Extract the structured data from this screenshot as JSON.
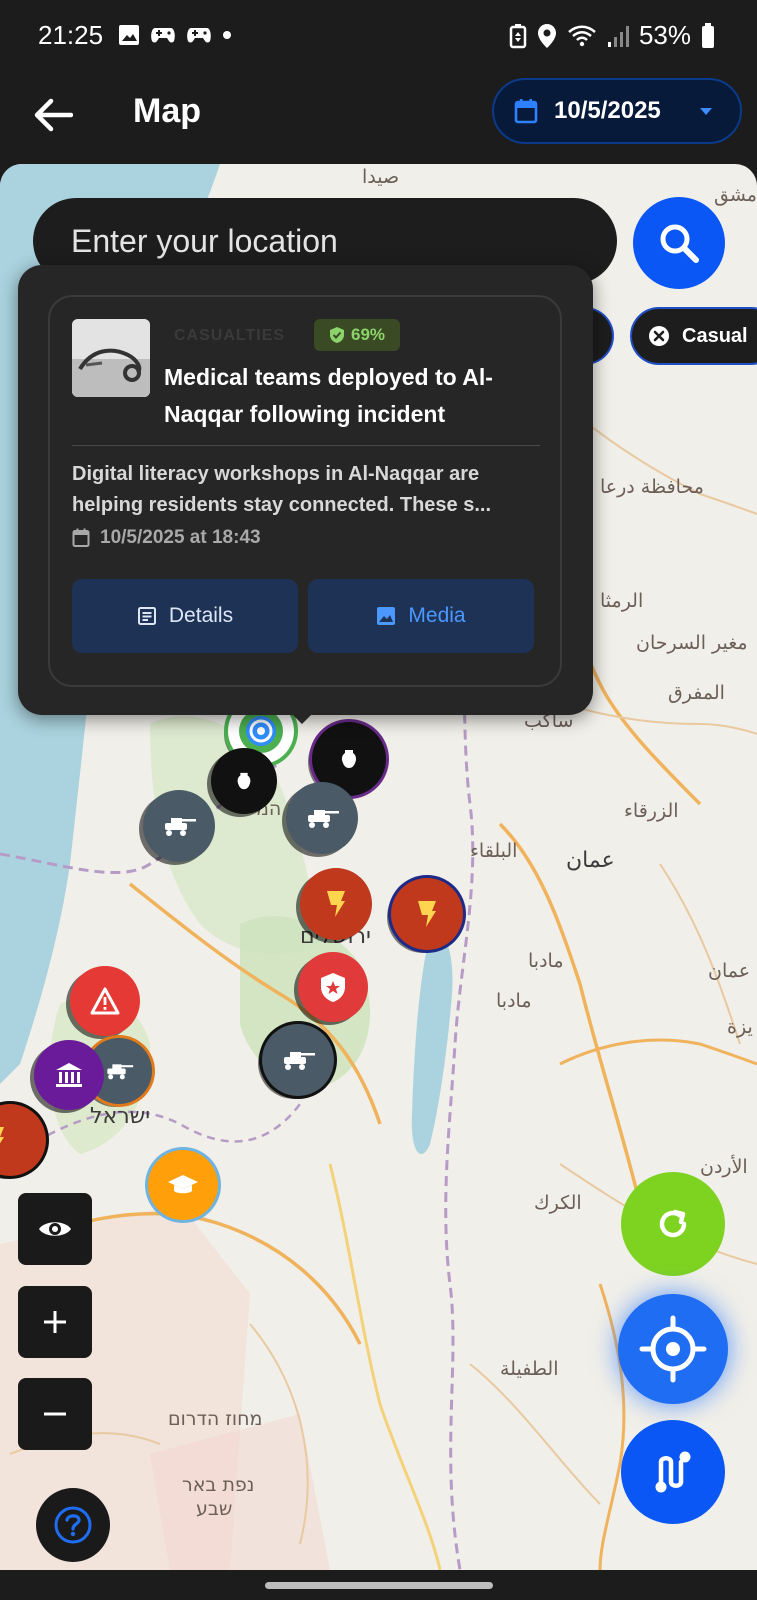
{
  "status_bar": {
    "time": "21:25",
    "battery": "53%",
    "icons_left": [
      "image-icon",
      "game-controller-icon",
      "game-controller-icon",
      "dot-icon"
    ],
    "icons_right": [
      "battery-saver-icon",
      "location-pin-icon",
      "wifi-icon",
      "signal-icon",
      "battery-icon"
    ]
  },
  "header": {
    "title": "Map",
    "date": "10/5/2025",
    "accent_color": "#0a57f5"
  },
  "search": {
    "placeholder": "Enter your location"
  },
  "filters": {
    "active_chip": "Casual"
  },
  "popup": {
    "category": "CASUALTIES",
    "confidence": "69%",
    "title": "Medical teams deployed to Al-Naqqar following incident",
    "description": "Digital literacy workshops in Al-Naqqar are helping residents stay connected. These s...",
    "date": "10/5/2025 at 18:43",
    "details_label": "Details",
    "media_label": "Media"
  },
  "map_labels": {
    "saida": "صيدا",
    "damascus": "دمشق",
    "daraa": "محافظة درعا",
    "ramtha": "الرمثا",
    "mughayyir": "مغير السرحان",
    "mafraq": "المفرق",
    "sakib": "ساكب",
    "zarqa": "الزرقاء",
    "balqa": "البلقاء",
    "amman": "عمان",
    "jerusalem": "ירושלים",
    "madaba1": "مادبا",
    "madaba2": "مادبا",
    "amman2": "عمان",
    "israel": "ישראל",
    "karak": "الكرك",
    "jordan": "الأردن",
    "tafila": "الطفيلة",
    "southern_district": "מחוז הדרום",
    "beersheba_top": "נפת באר",
    "beersheba_bottom": "שבע",
    "central_district": "מחוז המ",
    "jizah": "يزة"
  },
  "markers": [
    {
      "type": "target",
      "icon": "target-icon",
      "color": "#4caf50"
    },
    {
      "type": "vase",
      "icon": "vase-icon",
      "color": "#1a1a1a"
    },
    {
      "type": "vase",
      "icon": "vase-icon",
      "color": "#1a1a1a"
    },
    {
      "type": "military",
      "icon": "tank-icon",
      "color": "#4a5a66"
    },
    {
      "type": "military",
      "icon": "tank-icon",
      "color": "#4a5a66"
    },
    {
      "type": "explosion",
      "icon": "explosion-icon",
      "color": "#c0391c"
    },
    {
      "type": "explosion",
      "icon": "explosion-icon",
      "color": "#c0391c"
    },
    {
      "type": "security",
      "icon": "shield-icon",
      "color": "#e03a3a"
    },
    {
      "type": "military",
      "icon": "tank-icon",
      "color": "#4a5a66"
    },
    {
      "type": "warning",
      "icon": "warning-icon",
      "color": "#e53935"
    },
    {
      "type": "military",
      "icon": "tank-icon",
      "color": "#4a5a66"
    },
    {
      "type": "institution",
      "icon": "bank-icon",
      "color": "#6a1b9a"
    },
    {
      "type": "explosion",
      "icon": "explosion-icon",
      "color": "#c0391c"
    },
    {
      "type": "education",
      "icon": "graduation-cap-icon",
      "color": "#ff9f0a"
    }
  ],
  "controls": {
    "visibility": "eye-icon",
    "zoom_in": "plus-icon",
    "zoom_out": "minus-icon",
    "help": "help-icon",
    "refresh": "refresh-icon",
    "locate": "crosshair-icon",
    "route": "route-icon"
  }
}
